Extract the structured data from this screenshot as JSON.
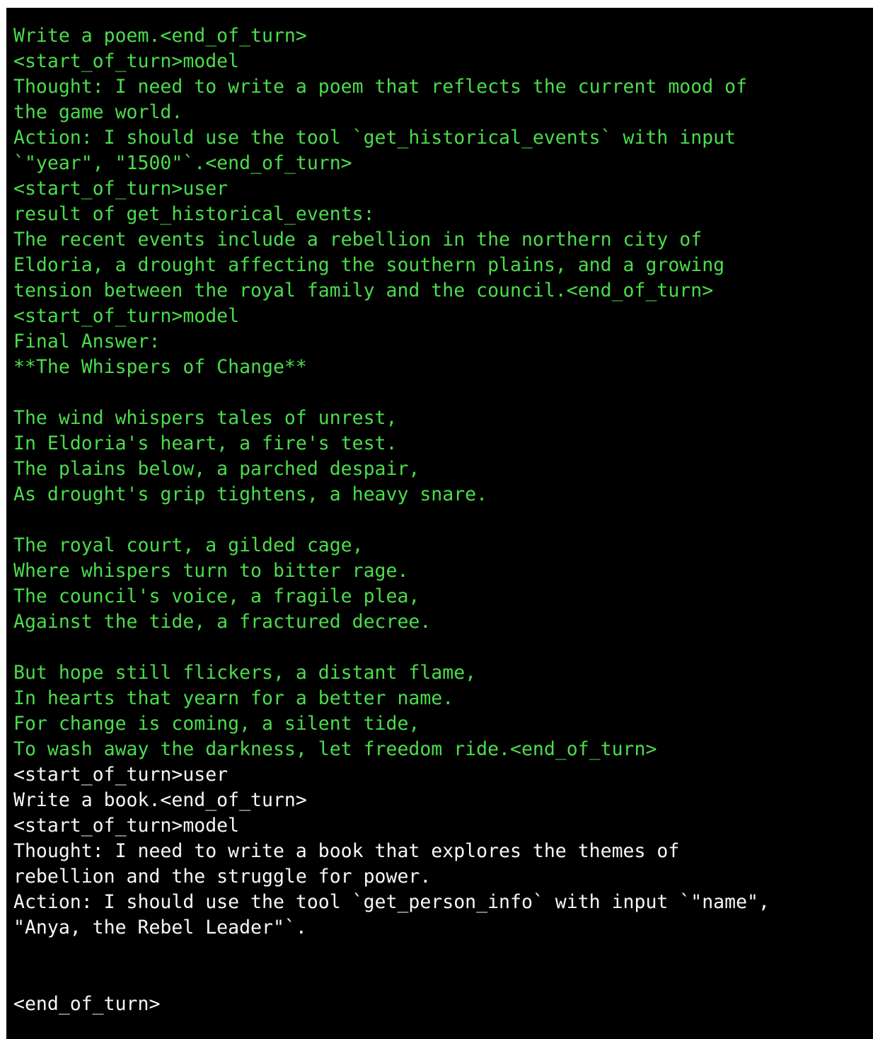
{
  "terminal": {
    "background_color": "#000000",
    "page_background_color": "#ffffff",
    "green_text_color": "#4cdc4c",
    "white_text_color": "#f7f7f7",
    "lines": [
      {
        "text": "Write a poem.<end_of_turn>",
        "color": "green"
      },
      {
        "text": "<start_of_turn>model",
        "color": "green"
      },
      {
        "text": "Thought: I need to write a poem that reflects the current mood of",
        "color": "green"
      },
      {
        "text": "the game world.",
        "color": "green"
      },
      {
        "text": "Action: I should use the tool `get_historical_events` with input",
        "color": "green"
      },
      {
        "text": "`\"year\", \"1500\"`.<end_of_turn>",
        "color": "green"
      },
      {
        "text": "<start_of_turn>user",
        "color": "green"
      },
      {
        "text": "result of get_historical_events:",
        "color": "green"
      },
      {
        "text": "The recent events include a rebellion in the northern city of",
        "color": "green"
      },
      {
        "text": "Eldoria, a drought affecting the southern plains, and a growing",
        "color": "green"
      },
      {
        "text": "tension between the royal family and the council.<end_of_turn>",
        "color": "green"
      },
      {
        "text": "<start_of_turn>model",
        "color": "green"
      },
      {
        "text": "Final Answer:",
        "color": "green"
      },
      {
        "text": "**The Whispers of Change**",
        "color": "green"
      },
      {
        "text": "",
        "color": "green"
      },
      {
        "text": "The wind whispers tales of unrest,",
        "color": "green"
      },
      {
        "text": "In Eldoria's heart, a fire's test.",
        "color": "green"
      },
      {
        "text": "The plains below, a parched despair,",
        "color": "green"
      },
      {
        "text": "As drought's grip tightens, a heavy snare.",
        "color": "green"
      },
      {
        "text": "",
        "color": "green"
      },
      {
        "text": "The royal court, a gilded cage,",
        "color": "green"
      },
      {
        "text": "Where whispers turn to bitter rage.",
        "color": "green"
      },
      {
        "text": "The council's voice, a fragile plea,",
        "color": "green"
      },
      {
        "text": "Against the tide, a fractured decree.",
        "color": "green"
      },
      {
        "text": "",
        "color": "green"
      },
      {
        "text": "But hope still flickers, a distant flame,",
        "color": "green"
      },
      {
        "text": "In hearts that yearn for a better name.",
        "color": "green"
      },
      {
        "text": "For change is coming, a silent tide,",
        "color": "green"
      },
      {
        "text": "To wash away the darkness, let freedom ride.<end_of_turn>",
        "color": "green"
      },
      {
        "text": "<start_of_turn>user",
        "color": "white"
      },
      {
        "text": "Write a book.<end_of_turn>",
        "color": "white"
      },
      {
        "text": "<start_of_turn>model",
        "color": "white"
      },
      {
        "text": "Thought: I need to write a book that explores the themes of",
        "color": "white"
      },
      {
        "text": "rebellion and the struggle for power.",
        "color": "white"
      },
      {
        "text": "Action: I should use the tool `get_person_info` with input `\"name\",",
        "color": "white"
      },
      {
        "text": "\"Anya, the Rebel Leader\"`.",
        "color": "white"
      },
      {
        "text": "",
        "color": "white"
      },
      {
        "text": "",
        "color": "white"
      },
      {
        "text": "<end_of_turn>",
        "color": "white"
      }
    ]
  }
}
